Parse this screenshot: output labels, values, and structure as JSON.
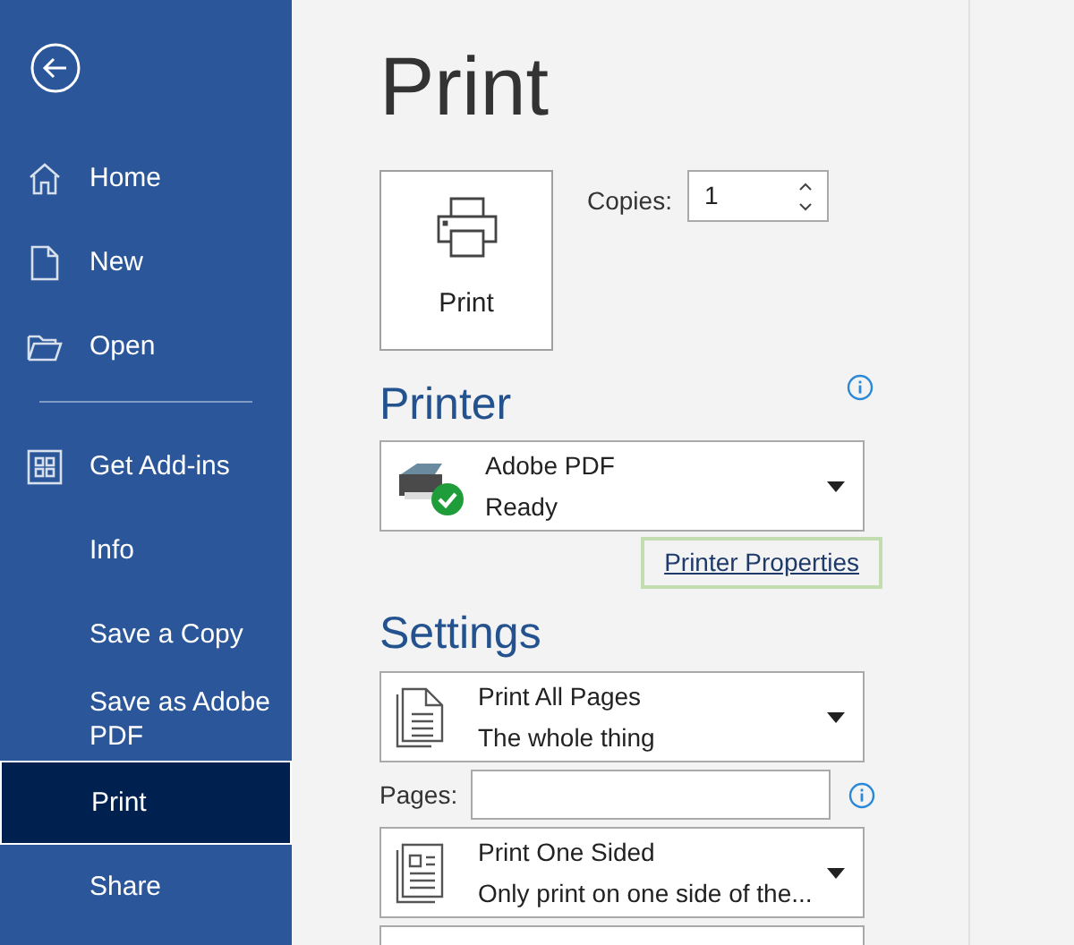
{
  "sidebar": {
    "items_top": [
      {
        "kind": "home",
        "label": "Home",
        "selected": false
      },
      {
        "kind": "new",
        "label": "New",
        "selected": false
      },
      {
        "kind": "open",
        "label": "Open",
        "selected": false
      }
    ],
    "items_bottom": [
      {
        "kind": "addins",
        "label": "Get Add-ins",
        "selected": false
      },
      {
        "kind": "plain",
        "label": "Info",
        "selected": false
      },
      {
        "kind": "plain",
        "label": "Save a Copy",
        "selected": false
      },
      {
        "kind": "plain",
        "label": "Save as Adobe PDF",
        "selected": false
      },
      {
        "kind": "plain",
        "label": "Print",
        "selected": true
      },
      {
        "kind": "plain",
        "label": "Share",
        "selected": false
      }
    ]
  },
  "title": "Print",
  "print_button": {
    "label": "Print"
  },
  "copies": {
    "label": "Copies:",
    "value": "1"
  },
  "printer": {
    "heading": "Printer",
    "name": "Adobe PDF",
    "status": "Ready",
    "properties_link": "Printer Properties"
  },
  "settings": {
    "heading": "Settings",
    "rows": [
      {
        "kind": "pages",
        "title": "Print All Pages",
        "subtitle": "The whole thing"
      },
      {
        "kind": "field",
        "label": "Pages:"
      },
      {
        "kind": "sides",
        "title": "Print One Sided",
        "subtitle": "Only print on one side of the..."
      }
    ]
  }
}
